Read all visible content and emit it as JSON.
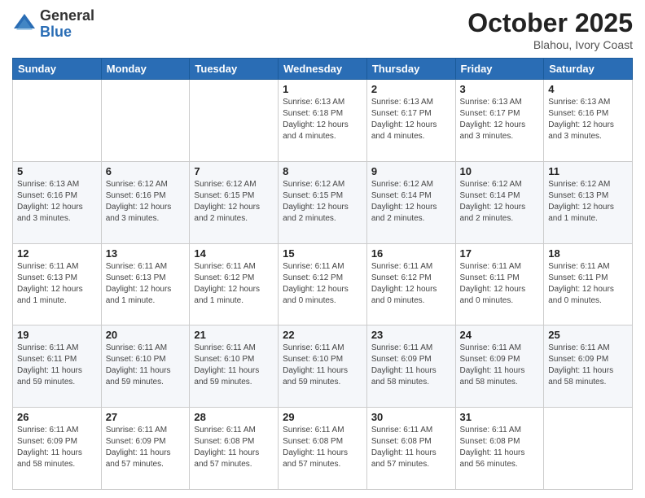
{
  "logo": {
    "general": "General",
    "blue": "Blue"
  },
  "header": {
    "month": "October 2025",
    "location": "Blahou, Ivory Coast"
  },
  "weekdays": [
    "Sunday",
    "Monday",
    "Tuesday",
    "Wednesday",
    "Thursday",
    "Friday",
    "Saturday"
  ],
  "weeks": [
    [
      {
        "day": "",
        "info": ""
      },
      {
        "day": "",
        "info": ""
      },
      {
        "day": "",
        "info": ""
      },
      {
        "day": "1",
        "info": "Sunrise: 6:13 AM\nSunset: 6:18 PM\nDaylight: 12 hours\nand 4 minutes."
      },
      {
        "day": "2",
        "info": "Sunrise: 6:13 AM\nSunset: 6:17 PM\nDaylight: 12 hours\nand 4 minutes."
      },
      {
        "day": "3",
        "info": "Sunrise: 6:13 AM\nSunset: 6:17 PM\nDaylight: 12 hours\nand 3 minutes."
      },
      {
        "day": "4",
        "info": "Sunrise: 6:13 AM\nSunset: 6:16 PM\nDaylight: 12 hours\nand 3 minutes."
      }
    ],
    [
      {
        "day": "5",
        "info": "Sunrise: 6:13 AM\nSunset: 6:16 PM\nDaylight: 12 hours\nand 3 minutes."
      },
      {
        "day": "6",
        "info": "Sunrise: 6:12 AM\nSunset: 6:16 PM\nDaylight: 12 hours\nand 3 minutes."
      },
      {
        "day": "7",
        "info": "Sunrise: 6:12 AM\nSunset: 6:15 PM\nDaylight: 12 hours\nand 2 minutes."
      },
      {
        "day": "8",
        "info": "Sunrise: 6:12 AM\nSunset: 6:15 PM\nDaylight: 12 hours\nand 2 minutes."
      },
      {
        "day": "9",
        "info": "Sunrise: 6:12 AM\nSunset: 6:14 PM\nDaylight: 12 hours\nand 2 minutes."
      },
      {
        "day": "10",
        "info": "Sunrise: 6:12 AM\nSunset: 6:14 PM\nDaylight: 12 hours\nand 2 minutes."
      },
      {
        "day": "11",
        "info": "Sunrise: 6:12 AM\nSunset: 6:13 PM\nDaylight: 12 hours\nand 1 minute."
      }
    ],
    [
      {
        "day": "12",
        "info": "Sunrise: 6:11 AM\nSunset: 6:13 PM\nDaylight: 12 hours\nand 1 minute."
      },
      {
        "day": "13",
        "info": "Sunrise: 6:11 AM\nSunset: 6:13 PM\nDaylight: 12 hours\nand 1 minute."
      },
      {
        "day": "14",
        "info": "Sunrise: 6:11 AM\nSunset: 6:12 PM\nDaylight: 12 hours\nand 1 minute."
      },
      {
        "day": "15",
        "info": "Sunrise: 6:11 AM\nSunset: 6:12 PM\nDaylight: 12 hours\nand 0 minutes."
      },
      {
        "day": "16",
        "info": "Sunrise: 6:11 AM\nSunset: 6:12 PM\nDaylight: 12 hours\nand 0 minutes."
      },
      {
        "day": "17",
        "info": "Sunrise: 6:11 AM\nSunset: 6:11 PM\nDaylight: 12 hours\nand 0 minutes."
      },
      {
        "day": "18",
        "info": "Sunrise: 6:11 AM\nSunset: 6:11 PM\nDaylight: 12 hours\nand 0 minutes."
      }
    ],
    [
      {
        "day": "19",
        "info": "Sunrise: 6:11 AM\nSunset: 6:11 PM\nDaylight: 11 hours\nand 59 minutes."
      },
      {
        "day": "20",
        "info": "Sunrise: 6:11 AM\nSunset: 6:10 PM\nDaylight: 11 hours\nand 59 minutes."
      },
      {
        "day": "21",
        "info": "Sunrise: 6:11 AM\nSunset: 6:10 PM\nDaylight: 11 hours\nand 59 minutes."
      },
      {
        "day": "22",
        "info": "Sunrise: 6:11 AM\nSunset: 6:10 PM\nDaylight: 11 hours\nand 59 minutes."
      },
      {
        "day": "23",
        "info": "Sunrise: 6:11 AM\nSunset: 6:09 PM\nDaylight: 11 hours\nand 58 minutes."
      },
      {
        "day": "24",
        "info": "Sunrise: 6:11 AM\nSunset: 6:09 PM\nDaylight: 11 hours\nand 58 minutes."
      },
      {
        "day": "25",
        "info": "Sunrise: 6:11 AM\nSunset: 6:09 PM\nDaylight: 11 hours\nand 58 minutes."
      }
    ],
    [
      {
        "day": "26",
        "info": "Sunrise: 6:11 AM\nSunset: 6:09 PM\nDaylight: 11 hours\nand 58 minutes."
      },
      {
        "day": "27",
        "info": "Sunrise: 6:11 AM\nSunset: 6:09 PM\nDaylight: 11 hours\nand 57 minutes."
      },
      {
        "day": "28",
        "info": "Sunrise: 6:11 AM\nSunset: 6:08 PM\nDaylight: 11 hours\nand 57 minutes."
      },
      {
        "day": "29",
        "info": "Sunrise: 6:11 AM\nSunset: 6:08 PM\nDaylight: 11 hours\nand 57 minutes."
      },
      {
        "day": "30",
        "info": "Sunrise: 6:11 AM\nSunset: 6:08 PM\nDaylight: 11 hours\nand 57 minutes."
      },
      {
        "day": "31",
        "info": "Sunrise: 6:11 AM\nSunset: 6:08 PM\nDaylight: 11 hours\nand 56 minutes."
      },
      {
        "day": "",
        "info": ""
      }
    ]
  ]
}
